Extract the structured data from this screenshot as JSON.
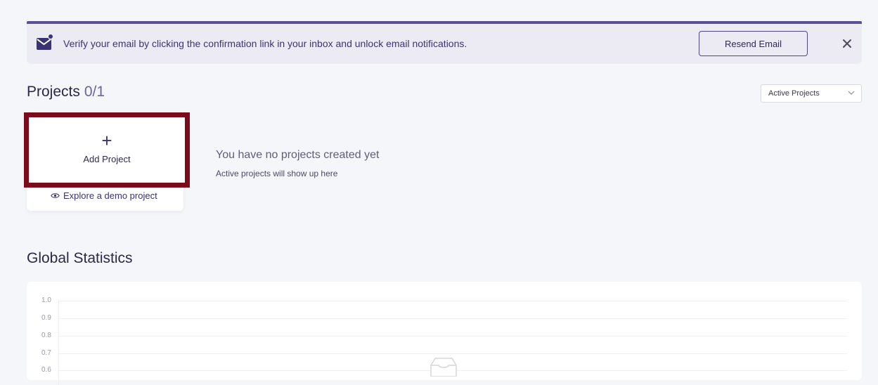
{
  "banner": {
    "message": "Verify your email by clicking the confirmation link in your inbox and unlock email notifications.",
    "resend_label": "Resend Email",
    "accent_color": "#5b4f96"
  },
  "projects": {
    "title": "Projects",
    "count": "0/1",
    "filter_selected": "Active Projects",
    "add_label": "Add Project",
    "add_symbol": "+",
    "demo_link": "Explore a demo project",
    "empty_title": "You have no projects created yet",
    "empty_subtitle": "Active projects will show up here",
    "highlight_color": "#7b0a1b"
  },
  "stats": {
    "title": "Global Statistics",
    "y_ticks": [
      "1.0",
      "0.9",
      "0.8",
      "0.7",
      "0.6"
    ]
  }
}
